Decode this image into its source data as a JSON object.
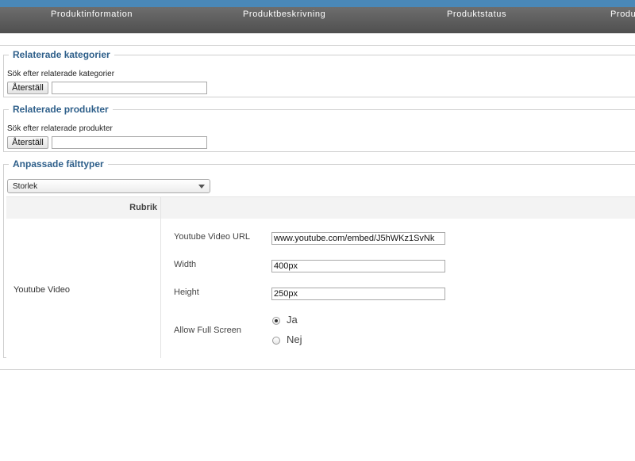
{
  "nav": {
    "tabs": [
      "Produktinformation",
      "Produktbeskrivning",
      "Produktstatus",
      "Produ"
    ]
  },
  "related_categories": {
    "title": "Relaterade kategorier",
    "hint": "Sök efter relaterade kategorier",
    "reset_label": "Återställ",
    "search_value": ""
  },
  "related_products": {
    "title": "Relaterade produkter",
    "hint": "Sök efter relaterade produkter",
    "reset_label": "Återställ",
    "search_value": ""
  },
  "custom_fields": {
    "title": "Anpassade fälttyper",
    "selected_type": "Storlek",
    "column_header": "Rubrik",
    "row_label": "Youtube Video",
    "fields": {
      "url_label": "Youtube Video URL",
      "url_value": "www.youtube.com/embed/J5hWKz1SvNk",
      "width_label": "Width",
      "width_value": "400px",
      "height_label": "Height",
      "height_value": "250px",
      "fullscreen_label": "Allow Full Screen",
      "option_yes": "Ja",
      "option_no": "Nej",
      "fullscreen_selected": "Ja"
    }
  },
  "colors": {
    "accent": "#4a88b8",
    "nav_bg": "#5a5a5a",
    "legend": "#2e5f8a"
  }
}
